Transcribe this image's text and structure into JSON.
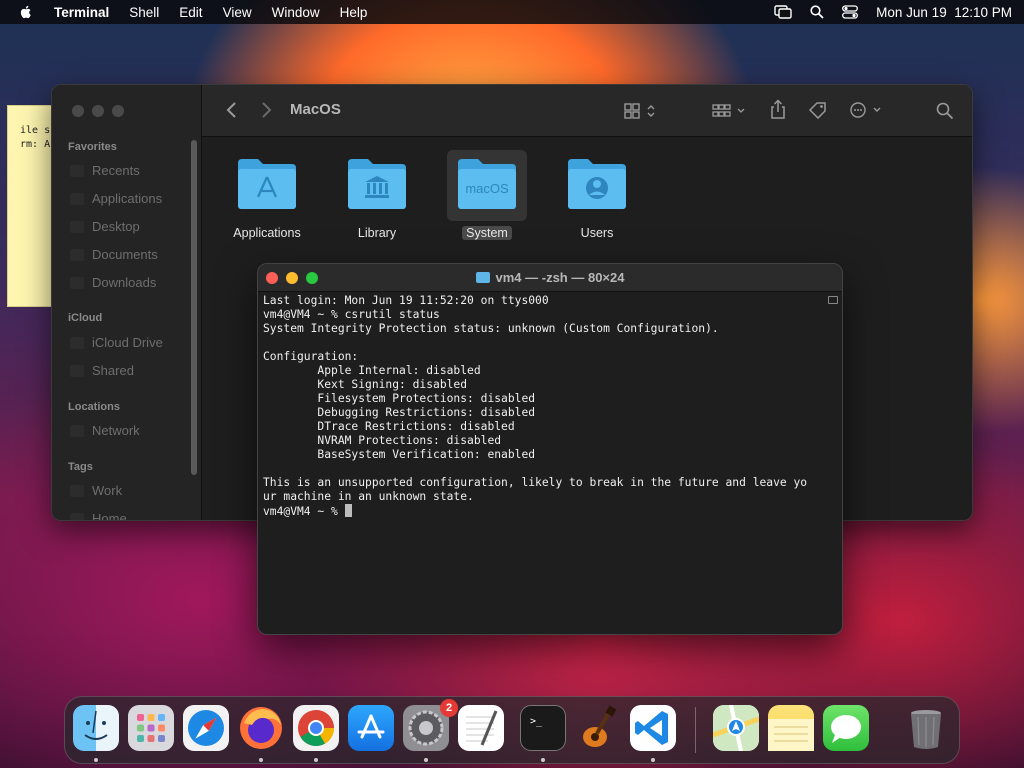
{
  "menubar": {
    "app_name": "Terminal",
    "items": [
      "Shell",
      "Edit",
      "View",
      "Window",
      "Help"
    ],
    "clock": "Mon Jun 19  12:10 PM"
  },
  "sticky": {
    "lines": [
      "ile s",
      "rm: A"
    ]
  },
  "finder": {
    "title": "MacOS",
    "sidebar": {
      "favorites_label": "Favorites",
      "favorites": [
        "Recents",
        "Applications",
        "Desktop",
        "Documents",
        "Downloads"
      ],
      "icloud_label": "iCloud",
      "icloud": [
        "iCloud Drive",
        "Shared"
      ],
      "locations_label": "Locations",
      "locations": [
        "Network"
      ],
      "tags_label": "Tags",
      "tags": [
        "Work",
        "Home"
      ]
    },
    "folders": [
      {
        "label": "Applications",
        "glyph": "A"
      },
      {
        "label": "Library",
        "glyph": "library"
      },
      {
        "label": "System",
        "glyph": "macOS",
        "selected": true
      },
      {
        "label": "Users",
        "glyph": "user"
      }
    ],
    "folder_color": "#4fb3ea"
  },
  "terminal": {
    "title": "vm4 — -zsh — 80×24",
    "lines": [
      "Last login: Mon Jun 19 11:52:20 on ttys000",
      "vm4@VM4 ~ % csrutil status",
      "System Integrity Protection status: unknown (Custom Configuration).",
      "",
      "Configuration:",
      "        Apple Internal: disabled",
      "        Kext Signing: disabled",
      "        Filesystem Protections: disabled",
      "        Debugging Restrictions: disabled",
      "        DTrace Restrictions: disabled",
      "        NVRAM Protections: disabled",
      "        BaseSystem Verification: enabled",
      "",
      "This is an unsupported configuration, likely to break in the future and leave yo",
      "ur machine in an unknown state."
    ],
    "prompt": "vm4@VM4 ~ % "
  },
  "dock": {
    "apps": [
      "Finder",
      "Launchpad",
      "Safari",
      "Firefox",
      "Chrome",
      "App Store",
      "System Settings",
      "TextEdit",
      "Terminal",
      "GarageBand",
      "Visual Studio Code",
      "Maps",
      "Notes",
      "Messages",
      "Trash"
    ],
    "settings_badge": "2"
  }
}
